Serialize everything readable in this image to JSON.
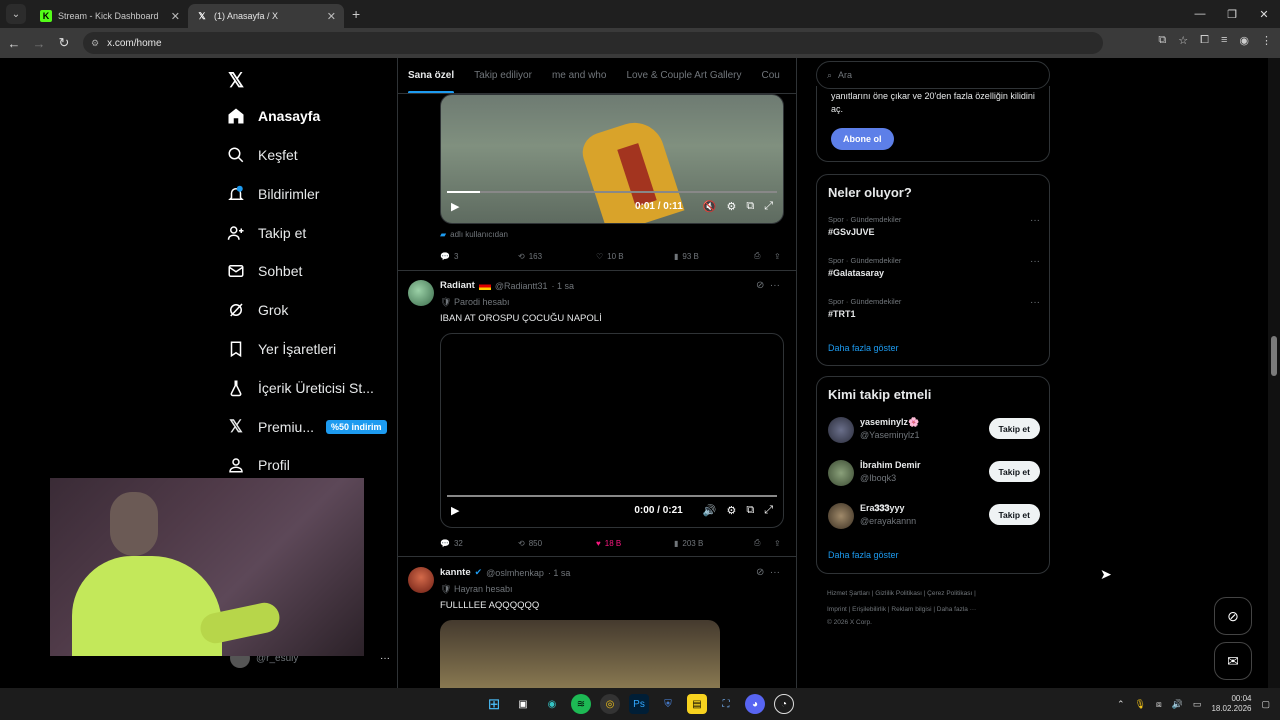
{
  "browser": {
    "tabs": [
      {
        "title": "Stream - Kick Dashboard",
        "favicon": "K",
        "color": "#53fc18"
      },
      {
        "title": "(1) Anasayfa / X",
        "favicon": "X",
        "color": "#ffffff"
      }
    ],
    "url": "x.com/home"
  },
  "nav": {
    "items": [
      {
        "label": "Anasayfa",
        "icon": "home-icon"
      },
      {
        "label": "Keşfet",
        "icon": "search-icon"
      },
      {
        "label": "Bildirimler",
        "icon": "bell-icon"
      },
      {
        "label": "Takip et",
        "icon": "add-user-icon"
      },
      {
        "label": "Sohbet",
        "icon": "mail-icon"
      },
      {
        "label": "Grok",
        "icon": "grok-icon"
      },
      {
        "label": "Yer İşaretleri",
        "icon": "bookmark-icon"
      },
      {
        "label": "İçerik Üreticisi St...",
        "icon": "flask-icon"
      },
      {
        "label": "Premiu...",
        "icon": "x-icon"
      },
      {
        "label": "Profil",
        "icon": "person-icon"
      }
    ],
    "promo": "%50 indirim",
    "account_handle": "@r_esuly"
  },
  "feed": {
    "tabs": [
      "Sana özel",
      "Takip ediliyor",
      "me and who",
      "Love & Couple Art Gallery",
      "Cou"
    ],
    "post0": {
      "video_time": "0:01 / 0:11",
      "from_user": "adlı kullanıcıdan",
      "replies": "3",
      "reposts": "163",
      "likes": "10 B",
      "views": "93 B"
    },
    "post1": {
      "name": "Radiant",
      "handle": "@Radiantt31",
      "time": "· 1 sa",
      "badge": "Parodi hesabı",
      "text": "IBAN AT OROSPU ÇOCUĞU NAPOLİ",
      "video_time": "0:00 / 0:21",
      "replies": "32",
      "reposts": "850",
      "likes": "18 B",
      "views": "203 B"
    },
    "post2": {
      "name": "kannte",
      "handle": "@oslmhenkap",
      "time": "· 1 sa",
      "badge": "Hayran hesabı",
      "text": "FULLLLEE AQQQQQQ"
    }
  },
  "sidebar": {
    "search_placeholder": "Ara",
    "premium_text": "yanıtlarını öne çıkar ve 20'den fazla özelliğin kilidini aç.",
    "subscribe": "Abone ol",
    "trends_title": "Neler oluyor?",
    "trends": [
      {
        "category": "Spor · Gündemdekiler",
        "tag": "#GSvJUVE"
      },
      {
        "category": "Spor · Gündemdekiler",
        "tag": "#Galatasaray"
      },
      {
        "category": "Spor · Gündemdekiler",
        "tag": "#TRT1"
      }
    ],
    "show_more": "Daha fazla göster",
    "follow_title": "Kimi takip etmeli",
    "follow": [
      {
        "name": "yaseminylz🌸",
        "handle": "@Yaseminylz1",
        "button": "Takip et"
      },
      {
        "name": "İbrahim Demir",
        "handle": "@Iboqk3",
        "button": "Takip et"
      },
      {
        "name": "Era𝟑𝟑𝟑yyy",
        "handle": "@erayakannn",
        "button": "Takip et"
      }
    ],
    "footer_line1": "Hizmet Şartları  |  Gizlilik Politikası  |  Çerez Politikası  |",
    "footer_line2": "Imprint  |  Erişilebilirlik  |  Reklam bilgisi  |  Daha fazla ···",
    "footer_line3": "© 2026 X Corp."
  },
  "taskbar": {
    "time": "00:04",
    "date": "18.02.2026"
  }
}
